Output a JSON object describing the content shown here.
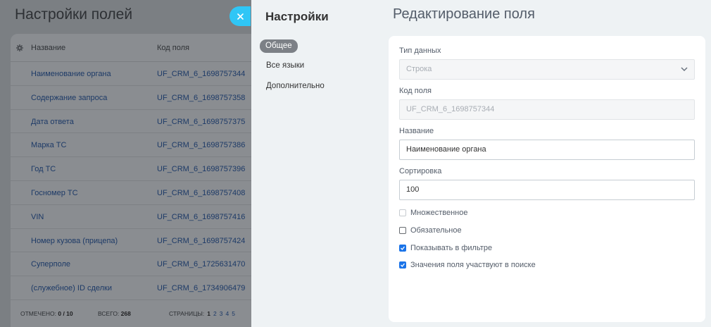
{
  "background": {
    "title": "Настройки полей",
    "columns": {
      "name": "Название",
      "code": "Код поля"
    },
    "rows": [
      {
        "name": "Наименование органа",
        "code": "UF_CRM_6_1698757344"
      },
      {
        "name": "Содержание запроса",
        "code": "UF_CRM_6_1698757358"
      },
      {
        "name": "Дата ответа",
        "code": "UF_CRM_6_1698757375"
      },
      {
        "name": "Марка ТС",
        "code": "UF_CRM_6_1698757386"
      },
      {
        "name": "Год ТС",
        "code": "UF_CRM_6_1698757396"
      },
      {
        "name": "Госномер ТС",
        "code": "UF_CRM_6_1698757408"
      },
      {
        "name": "VIN",
        "code": "UF_CRM_6_1698757416"
      },
      {
        "name": "Номер кузова (прицепа)",
        "code": "UF_CRM_6_1698757424"
      },
      {
        "name": "Суперполе",
        "code": "UF_CRM_6_1725631470"
      },
      {
        "name": "(служебное) ID сделки",
        "code": "UF_CRM_6_1734906479"
      }
    ],
    "footer": {
      "checked_label": "ОТМЕЧЕНО:",
      "checked_value": "0 / 10",
      "total_label": "ВСЕГО:",
      "total_value": "268",
      "pages_label": "СТРАНИЦЫ:",
      "pages": [
        "1",
        "2",
        "3",
        "4",
        "5"
      ]
    }
  },
  "slider": {
    "menu_title": "Настройки",
    "menu": [
      {
        "label": "Общее"
      },
      {
        "label": "Все языки"
      },
      {
        "label": "Дополнительно"
      }
    ],
    "edit_title": "Редактирование поля",
    "form": {
      "data_type_label": "Тип данных",
      "data_type_value": "Строка",
      "code_label": "Код поля",
      "code_value": "UF_CRM_6_1698757344",
      "name_label": "Название",
      "name_value": "Наименование органа",
      "sort_label": "Сортировка",
      "sort_value": "100",
      "checkboxes": [
        {
          "label": "Множественное",
          "checked": false,
          "disabled": true
        },
        {
          "label": "Обязательное",
          "checked": false,
          "disabled": false
        },
        {
          "label": "Показывать в фильтре",
          "checked": true,
          "disabled": false
        },
        {
          "label": "Значения поля участвуют в поиске",
          "checked": true,
          "disabled": false
        }
      ]
    }
  },
  "colors": {
    "close_button": "#2fc6f6",
    "checkbox_checked": "#1a73e8",
    "menu_active": "#7c8086"
  }
}
